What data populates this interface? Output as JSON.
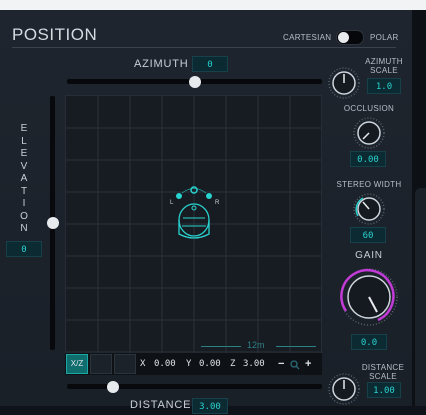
{
  "panel": {
    "title": "POSITION",
    "mode_left": "CARTESIAN",
    "mode_right": "POLAR"
  },
  "azimuth": {
    "label": "AZIMUTH",
    "value": "0",
    "slider_fraction": 0.5
  },
  "elevation": {
    "letters": [
      "E",
      "L",
      "E",
      "V",
      "A",
      "T",
      "I",
      "O",
      "N"
    ],
    "value": "0",
    "slider_fraction": 0.5
  },
  "distance": {
    "label": "DISTANCE",
    "value": "3.00",
    "slider_fraction": 0.18
  },
  "grid": {
    "scale_label": "12m",
    "head_labels": {
      "left": "L",
      "right": "R"
    }
  },
  "toolbar": {
    "view_label": "X/Z",
    "x_label": "X",
    "x_value": "0.00",
    "y_label": "Y",
    "y_value": "0.00",
    "z_label": "Z",
    "z_value": "3.00",
    "zoom_out": "−",
    "zoom_in": "+"
  },
  "right_controls": {
    "azimuth_scale": {
      "label_line1": "AZIMUTH",
      "label_line2": "SCALE",
      "value": "1.0"
    },
    "occlusion": {
      "label": "OCCLUSION",
      "value": "0.00"
    },
    "stereo_width": {
      "label": "STEREO WIDTH",
      "value": "60"
    },
    "gain": {
      "label": "GAIN",
      "value": "0.0"
    },
    "distance_scale": {
      "label_line1": "DISTANCE",
      "label_line2": "SCALE",
      "value": "1.00"
    }
  },
  "colors": {
    "accent": "#29d3d0",
    "gain_arc": "#c23bd6",
    "panel": "#1e252e"
  }
}
